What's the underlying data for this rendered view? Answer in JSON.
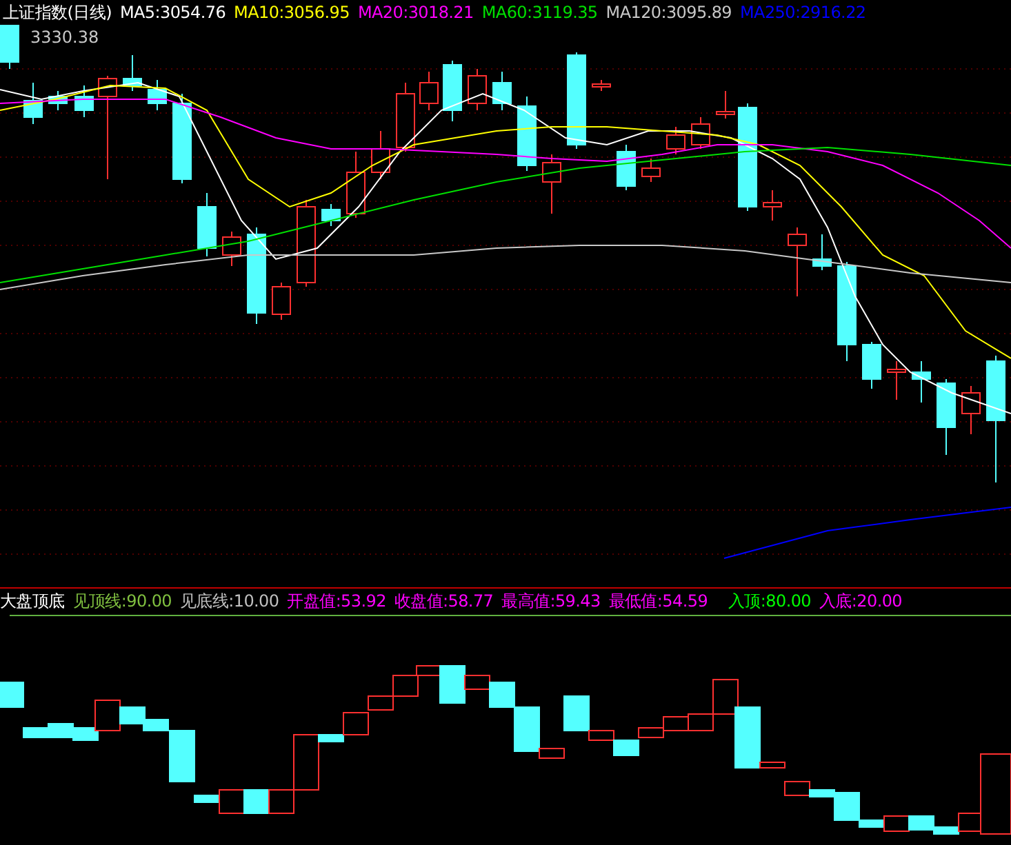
{
  "main_panel": {
    "title": "上证指数(日线)",
    "indicators": [
      {
        "label": "MA5:3054.76",
        "color": "#ffffff"
      },
      {
        "label": "MA10:3056.95",
        "color": "#ffff00"
      },
      {
        "label": "MA20:3018.21",
        "color": "#ff00ff"
      },
      {
        "label": "MA60:3119.35",
        "color": "#00e000"
      },
      {
        "label": "MA120:3095.89",
        "color": "#c8c8c8"
      },
      {
        "label": "MA250:2916.22",
        "color": "#0000ff"
      }
    ],
    "price_label": "3330.38"
  },
  "lower_panel": {
    "title": "大盘顶底",
    "values": [
      {
        "label": "见顶线:90.00",
        "color": "#80c040"
      },
      {
        "label": "见底线:10.00",
        "color": "#c0c0c0"
      },
      {
        "label": "开盘值:53.92",
        "color": "#ff00ff"
      },
      {
        "label": "收盘值:58.77",
        "color": "#ff00ff"
      },
      {
        "label": "最高值:59.43",
        "color": "#ff00ff"
      },
      {
        "label": "最低值:54.59",
        "color": "#ff00ff"
      }
    ],
    "zones": [
      {
        "label": "入顶:80.00",
        "color": "#00ff00"
      },
      {
        "label": "入底:20.00",
        "color": "#ff00ff"
      }
    ]
  }
}
